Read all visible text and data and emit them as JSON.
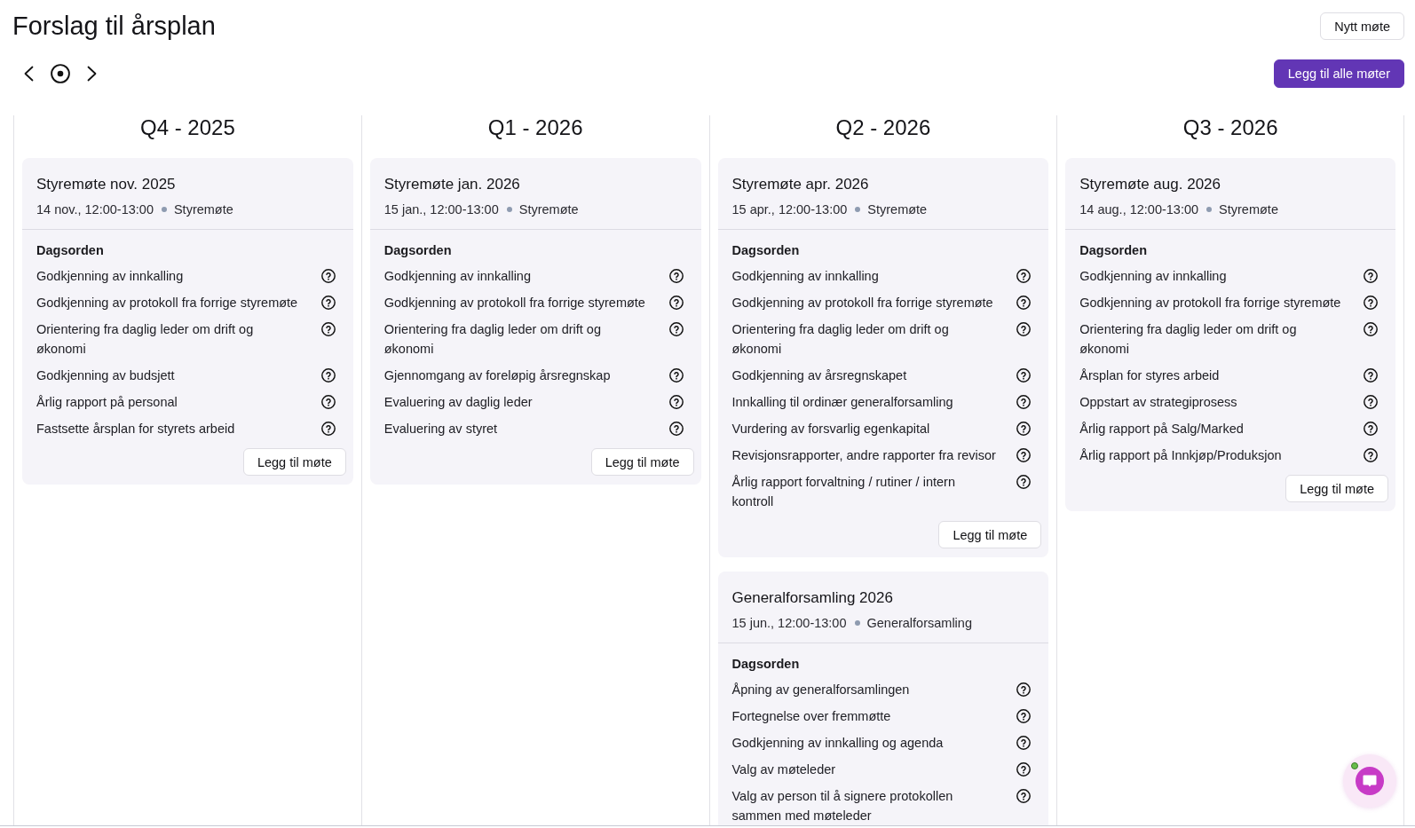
{
  "page": {
    "title": "Forslag til årsplan"
  },
  "toolbar": {
    "new_meeting_button": "Nytt møte",
    "add_all_button": "Legg til alle møter"
  },
  "quarters": [
    {
      "title": "Q4 - 2025",
      "meetings": [
        {
          "title": "Styremøte nov. 2025",
          "date_time": "14 nov., 12:00-13:00",
          "type": "Styremøte",
          "agenda_heading": "Dagsorden",
          "agenda": [
            "Godkjenning av innkalling",
            "Godkjenning av protokoll fra forrige styremøte",
            "Orientering fra daglig leder om drift og økonomi",
            "Godkjenning av budsjett",
            "Årlig rapport på personal",
            "Fastsette årsplan for styrets arbeid"
          ],
          "add_button": "Legg til møte"
        }
      ]
    },
    {
      "title": "Q1 - 2026",
      "meetings": [
        {
          "title": "Styremøte jan. 2026",
          "date_time": "15 jan., 12:00-13:00",
          "type": "Styremøte",
          "agenda_heading": "Dagsorden",
          "agenda": [
            "Godkjenning av innkalling",
            "Godkjenning av protokoll fra forrige styremøte",
            "Orientering fra daglig leder om drift og økonomi",
            "Gjennomgang av foreløpig årsregnskap",
            "Evaluering av daglig leder",
            "Evaluering av styret"
          ],
          "add_button": "Legg til møte"
        }
      ]
    },
    {
      "title": "Q2 - 2026",
      "meetings": [
        {
          "title": "Styremøte apr. 2026",
          "date_time": "15 apr., 12:00-13:00",
          "type": "Styremøte",
          "agenda_heading": "Dagsorden",
          "agenda": [
            "Godkjenning av innkalling",
            "Godkjenning av protokoll fra forrige styremøte",
            "Orientering fra daglig leder om drift og økonomi",
            "Godkjenning av årsregnskapet",
            "Innkalling til ordinær generalforsamling",
            "Vurdering av forsvarlig egenkapital",
            "Revisjonsrapporter, andre rapporter fra revisor",
            "Årlig rapport forvaltning / rutiner / intern kontroll"
          ],
          "add_button": "Legg til møte"
        },
        {
          "title": "Generalforsamling 2026",
          "date_time": "15 jun., 12:00-13:00",
          "type": "Generalforsamling",
          "agenda_heading": "Dagsorden",
          "agenda": [
            "Åpning av generalforsamlingen",
            "Fortegnelse over fremmøtte",
            "Godkjenning av innkalling og agenda",
            "Valg av møteleder",
            "Valg av person til å signere protokollen sammen med møteleder"
          ]
        }
      ]
    },
    {
      "title": "Q3 - 2026",
      "meetings": [
        {
          "title": "Styremøte aug. 2026",
          "date_time": "14 aug., 12:00-13:00",
          "type": "Styremøte",
          "agenda_heading": "Dagsorden",
          "agenda": [
            "Godkjenning av innkalling",
            "Godkjenning av protokoll fra forrige styremøte",
            "Orientering fra daglig leder om drift og økonomi",
            "Årsplan for styres arbeid",
            "Oppstart av strategiprosess",
            "Årlig rapport på Salg/Marked",
            "Årlig rapport på Innkjøp/Produksjon"
          ],
          "add_button": "Legg til møte"
        }
      ]
    }
  ]
}
